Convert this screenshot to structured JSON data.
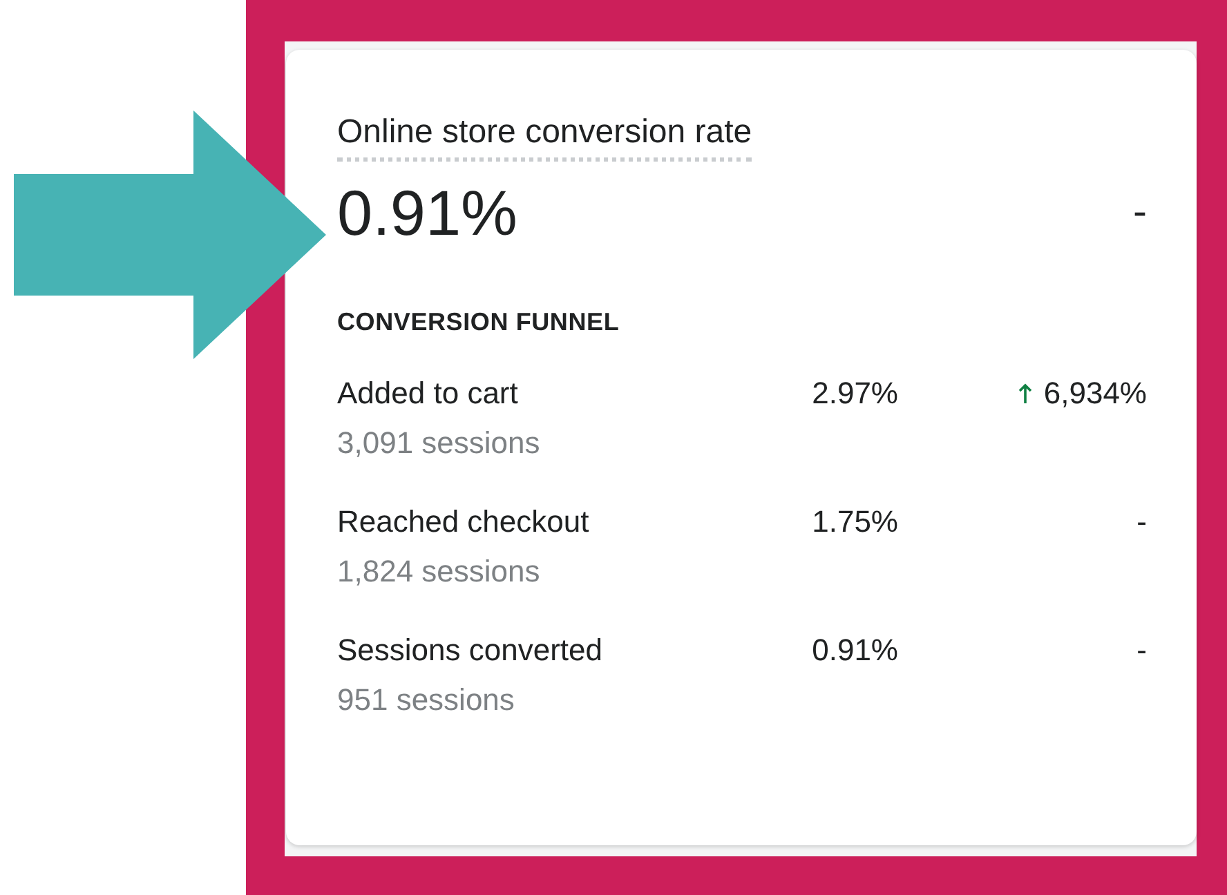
{
  "card": {
    "title": "Online store conversion rate",
    "value": "0.91%",
    "comparison": "-",
    "funnel": {
      "heading": "CONVERSION FUNNEL",
      "rows": [
        {
          "label": "Added to cart",
          "sessions": "3,091 sessions",
          "rate": "2.97%",
          "change": "6,934%",
          "rising": true
        },
        {
          "label": "Reached checkout",
          "sessions": "1,824 sessions",
          "rate": "1.75%",
          "change": "-",
          "rising": false
        },
        {
          "label": "Sessions converted",
          "sessions": "951 sessions",
          "rate": "0.91%",
          "change": "-",
          "rising": false
        }
      ]
    }
  }
}
